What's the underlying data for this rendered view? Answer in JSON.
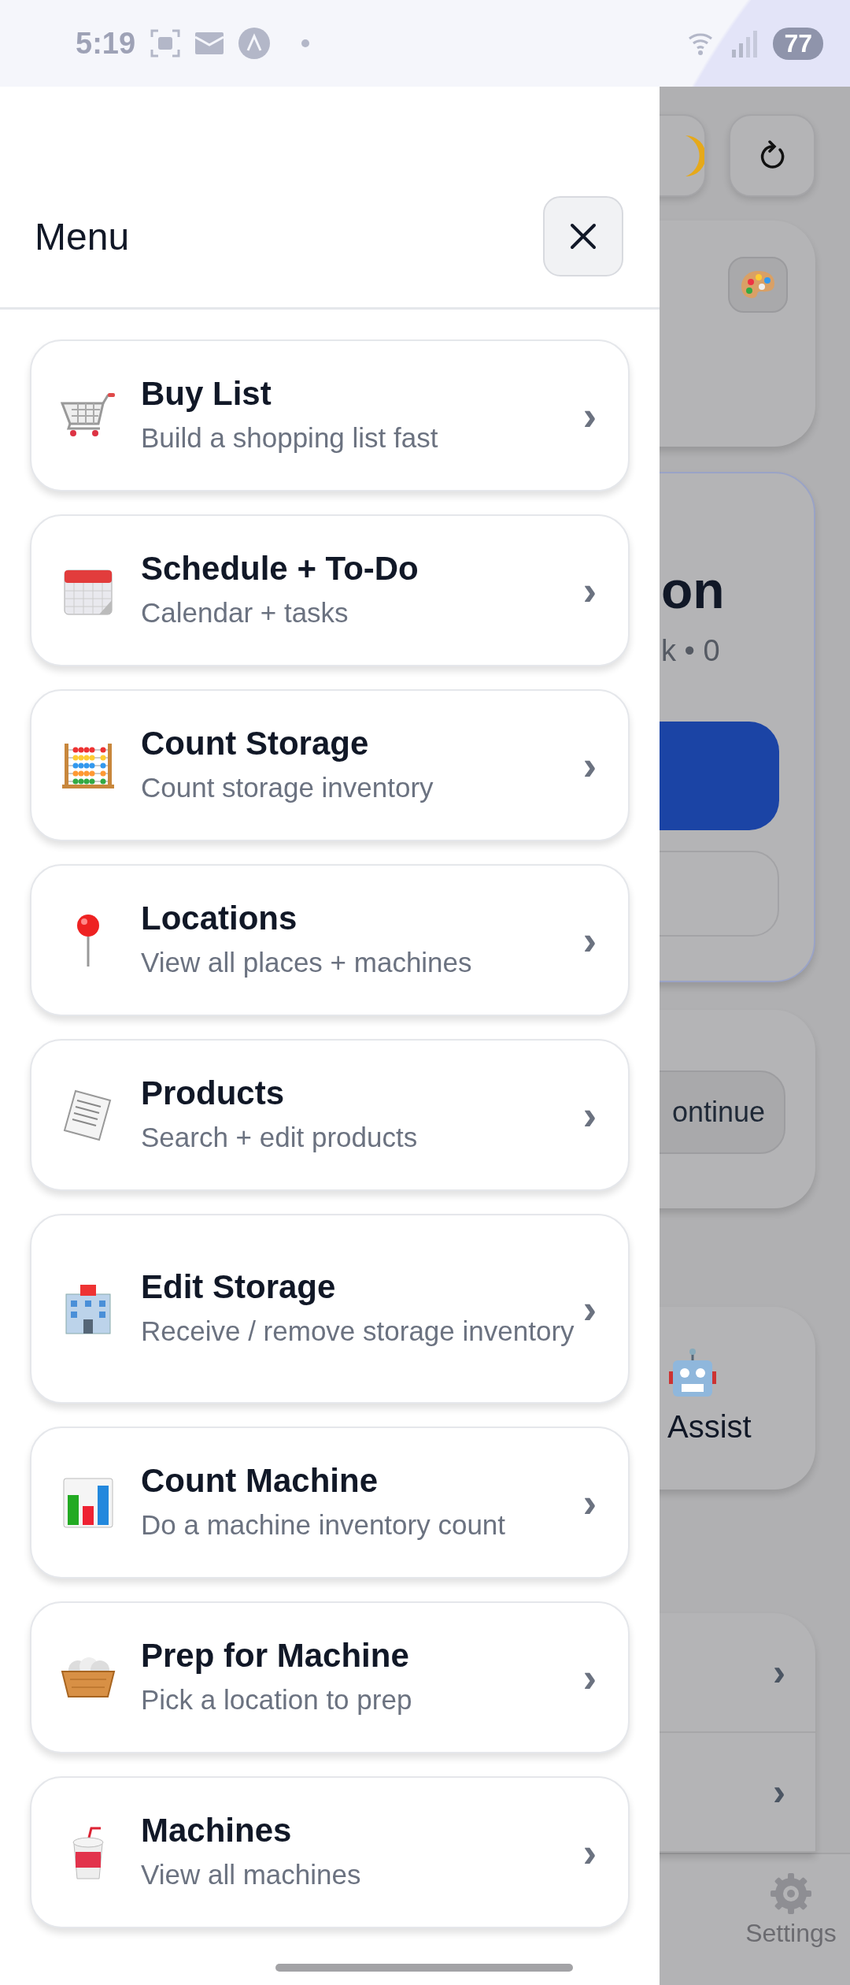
{
  "status_bar": {
    "time": "5:19",
    "battery": "77"
  },
  "menu": {
    "title": "Menu",
    "items": [
      {
        "title": "Buy List",
        "subtitle": "Build a shopping list fast",
        "chevron": "›"
      },
      {
        "title": "Schedule + To-Do",
        "subtitle": "Calendar + tasks",
        "chevron": "›"
      },
      {
        "title": "Count Storage",
        "subtitle": "Count storage inventory",
        "chevron": "›"
      },
      {
        "title": "Locations",
        "subtitle": "View all places + machines",
        "chevron": "›"
      },
      {
        "title": "Products",
        "subtitle": "Search + edit products",
        "chevron": "›"
      },
      {
        "title": "Edit Storage",
        "subtitle": "Receive / remove storage inventory",
        "chevron": "›"
      },
      {
        "title": "Count Machine",
        "subtitle": "Do a machine inventory count",
        "chevron": "›"
      },
      {
        "title": "Prep for Machine",
        "subtitle": "Pick a location to prep",
        "chevron": "›"
      },
      {
        "title": "Machines",
        "subtitle": "View all machines",
        "chevron": "›"
      }
    ]
  },
  "background": {
    "title_fragment": "on",
    "stats_fragment": "k • 0",
    "continue_fragment": "ontinue",
    "assist_label": "Assist",
    "list_chevrons": [
      "›",
      "›"
    ],
    "nav_label": "Settings"
  }
}
